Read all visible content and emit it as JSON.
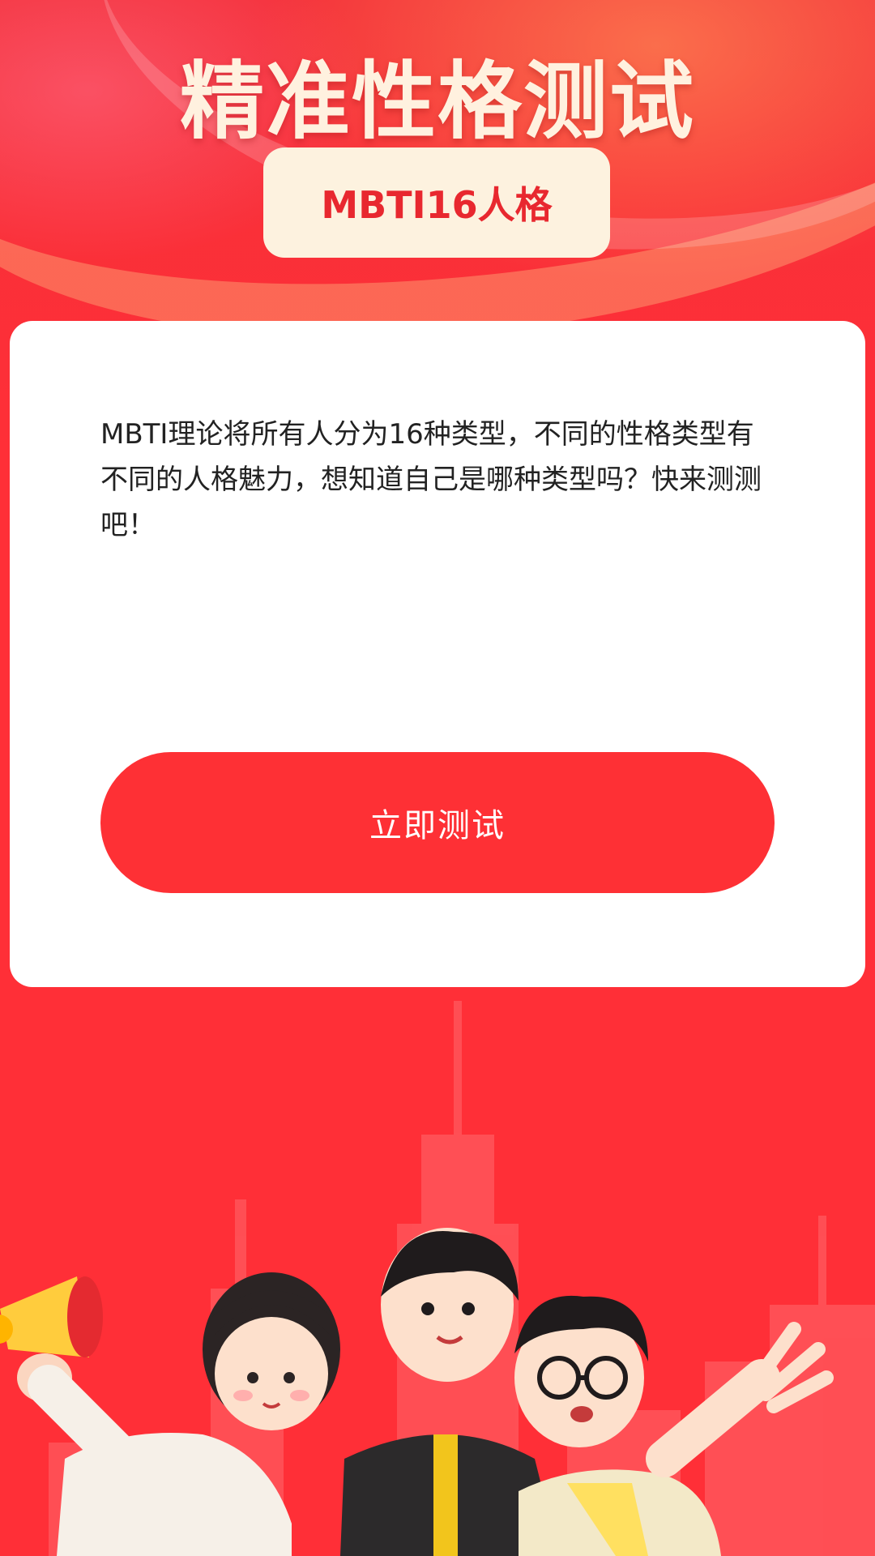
{
  "header": {
    "title": "精准性格测试",
    "tag": "MBTI16人格"
  },
  "card": {
    "description": "MBTI理论将所有人分为16种类型，不同的性格类型有不同的人格魅力，想知道自己是哪种类型吗？快来测测吧！",
    "button_label": "立即测试"
  },
  "colors": {
    "primary": "#fe3035",
    "tag_bg": "#fdf2df",
    "title_text": "#fff1df",
    "background": "#ff2f37"
  },
  "illustration": {
    "icons": [
      "city-skyline-icon",
      "megaphone-icon",
      "character-girl-icon",
      "character-boy-icon",
      "character-glasses-icon"
    ]
  }
}
